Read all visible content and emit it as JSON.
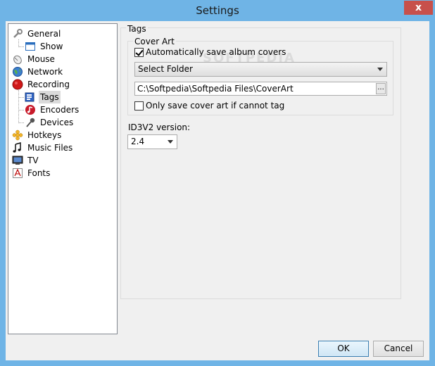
{
  "window": {
    "title": "Settings",
    "close_glyph": "x"
  },
  "tree": {
    "items": [
      {
        "label": "General",
        "icon": "wrench-icon"
      },
      {
        "label": "Show",
        "icon": "window-icon"
      },
      {
        "label": "Mouse",
        "icon": "mouse-icon"
      },
      {
        "label": "Network",
        "icon": "globe-icon"
      },
      {
        "label": "Recording",
        "icon": "record-icon"
      },
      {
        "label": "Tags",
        "icon": "tag-icon"
      },
      {
        "label": "Encoders",
        "icon": "encoder-icon"
      },
      {
        "label": "Devices",
        "icon": "microphone-icon"
      },
      {
        "label": "Hotkeys",
        "icon": "hotkey-icon"
      },
      {
        "label": "Music Files",
        "icon": "music-note-icon"
      },
      {
        "label": "TV",
        "icon": "tv-icon"
      },
      {
        "label": "Fonts",
        "icon": "font-icon"
      }
    ],
    "selected": "Tags"
  },
  "tags": {
    "section_title": "Tags",
    "cover_art": {
      "group_title": "Cover Art",
      "auto_save_label": "Automatically save album covers",
      "auto_save_checked": true,
      "folder_select_value": "Select Folder",
      "path_value": "C:\\Softpedia\\Softpedia Files\\CoverArt",
      "browse_label": "...",
      "only_if_no_tag_label": "Only save cover art if cannot tag",
      "only_if_no_tag_checked": false
    },
    "id3v2": {
      "label": "ID3V2 version:",
      "value": "2.4"
    }
  },
  "buttons": {
    "ok": "OK",
    "cancel": "Cancel"
  },
  "watermark": "SOFTPEDIA"
}
